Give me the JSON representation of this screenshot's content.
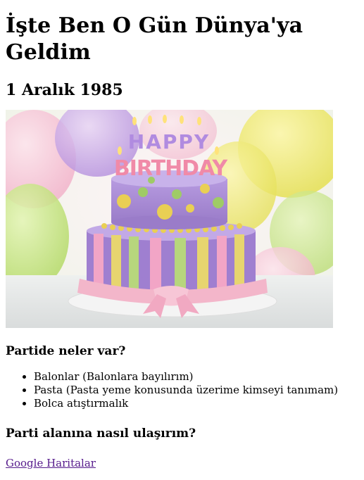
{
  "page": {
    "title": "İşte Ben O Gün Dünya'ya Geldim",
    "date": "1 Aralık 1985",
    "image": {
      "alt": "Doğum günü pastası",
      "candle_text_top": "HAPPY",
      "candle_text_bottom": "BIRTHDAY",
      "colors": {
        "cake_top": "#a98bd6",
        "cake_bottom": "#9f7fd0",
        "stripe_yellow": "#e7d56f",
        "stripe_pink": "#f2a5c6",
        "stripe_green": "#b7d67d",
        "ribbon": "#f3b6ca",
        "dot_yellow": "#e9cf54",
        "dot_green": "#9fcb66"
      }
    },
    "section_party": {
      "heading": "Partide neler var?",
      "items": [
        "Balonlar (Balonlara bayılırım)",
        "Pasta (Pasta yeme konusunda üzerime kimseyi tanımam)",
        "Bolca atıştırmalık"
      ]
    },
    "section_location": {
      "heading": "Parti alanına nasıl ulaşırım?",
      "link_text": "Google Haritalar"
    }
  }
}
